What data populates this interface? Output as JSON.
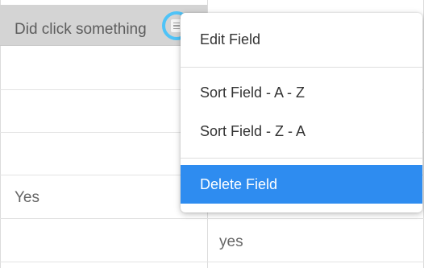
{
  "table": {
    "header_label": "Did click something",
    "rows": [
      {
        "col1": "",
        "col2": ""
      },
      {
        "col1": "",
        "col2": ""
      },
      {
        "col1": "",
        "col2": ""
      },
      {
        "col1": "Yes",
        "col2": ""
      },
      {
        "col1": "",
        "col2": "yes"
      }
    ]
  },
  "field_menu": {
    "trigger_icon": "document-icon",
    "items": [
      {
        "label": "Edit Field"
      },
      {
        "label": "Sort Field - A - Z"
      },
      {
        "label": "Sort Field - Z - A"
      },
      {
        "label": "Delete Field"
      }
    ],
    "active_item": "Delete Field",
    "accent_color": "#2e8cf0",
    "trigger_ring_color": "#4fc3f7"
  }
}
